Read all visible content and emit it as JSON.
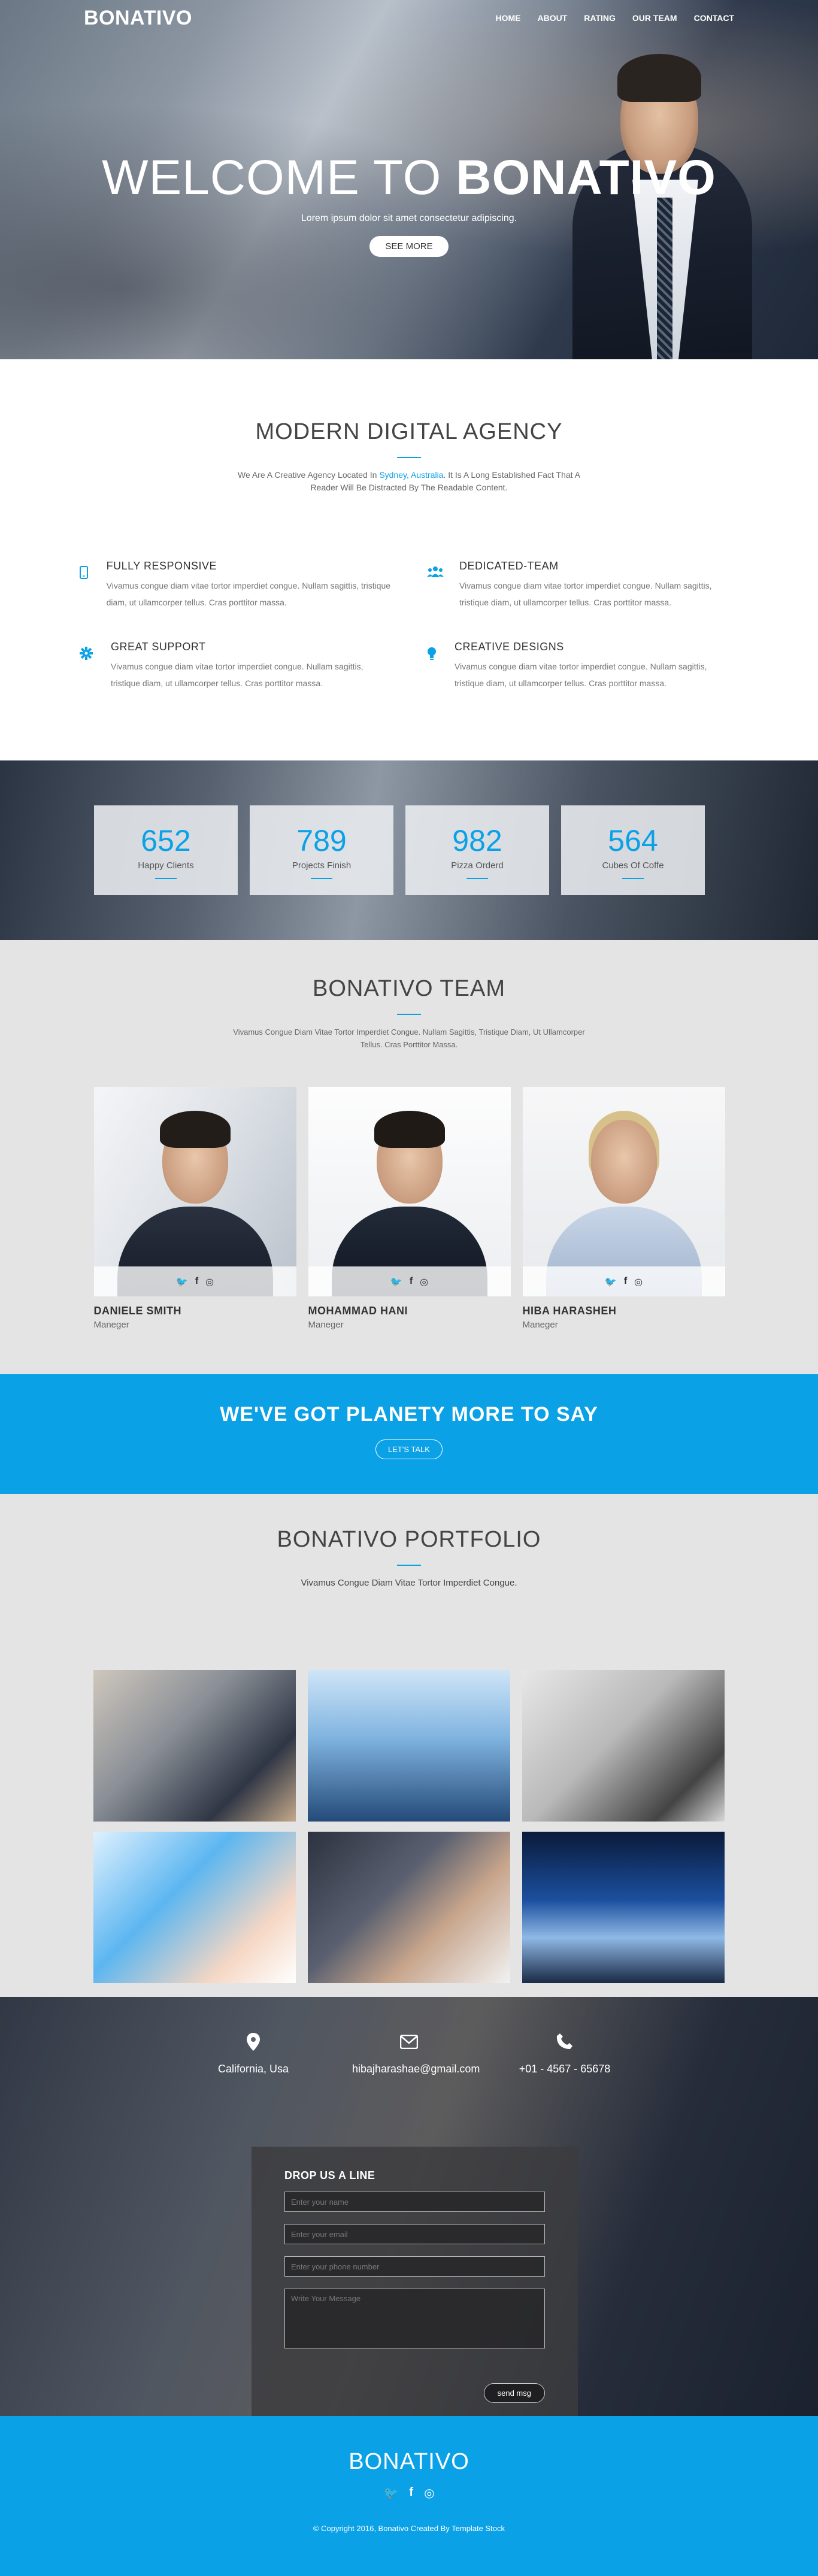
{
  "nav": {
    "logo": "BONATIVO",
    "items": [
      "HOME",
      "ABOUT",
      "RATING",
      "OUR TEAM",
      "CONTACT"
    ]
  },
  "hero": {
    "title_part1": "WELCOME TO ",
    "title_part2": "BONATIVO",
    "subtitle": "Lorem ipsum dolor sit amet consectetur adipiscing.",
    "button": "SEE MORE"
  },
  "about": {
    "title": "MODERN DIGITAL AGENCY",
    "desc_part1": "We Are A Creative Agency Located In ",
    "desc_link": "Sydney, Australia",
    "desc_part2": ". It Is A Long Established Fact That A Reader Will Be Distracted By The Readable Content.",
    "features": [
      {
        "icon": "mobile-icon",
        "title": "FULLY RESPONSIVE",
        "text": "Vivamus congue diam vitae tortor imperdiet congue. Nullam sagittis, tristique diam, ut ullamcorper tellus. Cras porttitor massa."
      },
      {
        "icon": "team-icon",
        "title": "DEDICATED-TEAM",
        "text": "Vivamus congue diam vitae tortor imperdiet congue. Nullam sagittis, tristique diam, ut ullamcorper tellus. Cras porttitor massa."
      },
      {
        "icon": "gear-icon",
        "title": "GREAT SUPPORT",
        "text": "Vivamus congue diam vitae tortor imperdiet congue. Nullam sagittis, tristique diam, ut ullamcorper tellus. Cras porttitor massa."
      },
      {
        "icon": "bulb-icon",
        "title": "CREATIVE DESIGNS",
        "text": "Vivamus congue diam vitae tortor imperdiet congue. Nullam sagittis, tristique diam, ut ullamcorper tellus. Cras porttitor massa."
      }
    ]
  },
  "stats": [
    {
      "value": "652",
      "label": "Happy Clients"
    },
    {
      "value": "789",
      "label": "Projects Finish"
    },
    {
      "value": "982",
      "label": "Pizza Orderd"
    },
    {
      "value": "564",
      "label": "Cubes Of Coffe"
    }
  ],
  "team": {
    "title": "BONATIVO TEAM",
    "desc": "Vivamus Congue Diam Vitae Tortor Imperdiet Congue. Nullam Sagittis, Tristique Diam, Ut Ullamcorper Tellus. Cras Porttitor Massa.",
    "members": [
      {
        "name": "DANIELE SMITH",
        "role": "Maneger"
      },
      {
        "name": "MOHAMMAD HANI",
        "role": "Maneger"
      },
      {
        "name": "HIBA HARASHEH",
        "role": "Maneger"
      }
    ]
  },
  "cta": {
    "title": "WE'VE GOT PLANETY MORE TO SAY",
    "button": "LET'S TALK"
  },
  "portfolio": {
    "title": "BONATIVO PORTFOLIO",
    "desc": "Vivamus Congue Diam Vitae Tortor Imperdiet Congue."
  },
  "contact": {
    "location": "California, Usa",
    "email": "hibajharashae@gmail.com",
    "phone": "+01 - 4567 - 65678",
    "form_title": "DROP US A LINE",
    "name_placeholder": "Enter your name",
    "email_placeholder": "Enter your email",
    "phone_placeholder": "Enter your phone number",
    "message_placeholder": "Write Your Message",
    "send": "send msg"
  },
  "footer": {
    "logo": "BONATIVO",
    "copyright": "© Copyright 2016, Bonativo Created By Template Stock"
  },
  "colors": {
    "accent": "#0aa1e6",
    "light_bg": "#e4e4e4"
  }
}
